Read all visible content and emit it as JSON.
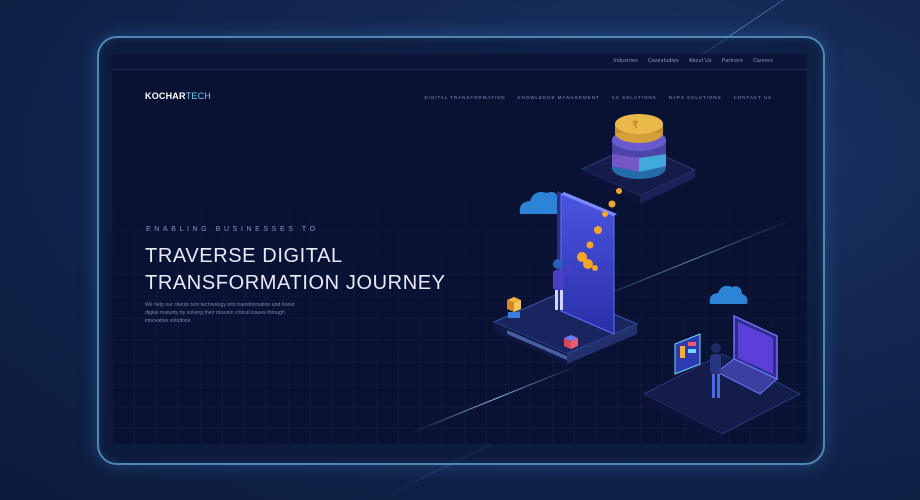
{
  "site": {
    "logo_part1": "KOCHAR",
    "logo_part2": "TECH"
  },
  "utility_nav": [
    "Industries",
    "Casestudies",
    "About Us",
    "Partners",
    "Careers"
  ],
  "main_nav": [
    "DIGITAL TRANSFORMATION",
    "KNOWLEDGE MANAGEMENT",
    "CX SOLUTIONS",
    "NAPS SOLUTIONS",
    "CONTACT US"
  ],
  "hero": {
    "eyebrow": "ENABLING BUSINESSES TO",
    "headline_line1": "TRAVERSE DIGITAL",
    "headline_line2": "TRANSFORMATION JOURNEY",
    "description": "We help our clients turn technology into transformation and boost digital maturity by solving their mission critical issues through innovative solutions."
  },
  "illustration": {
    "coin_symbol": "₹"
  },
  "colors": {
    "accent": "#6fd6ff",
    "screen_bg": "#0a1233",
    "frame_border": "#4f86b4"
  }
}
